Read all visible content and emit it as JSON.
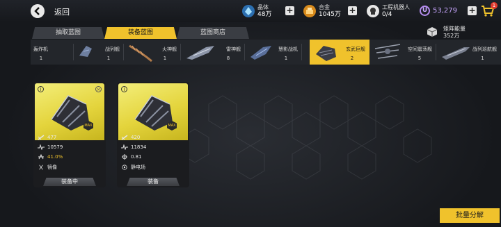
{
  "header": {
    "back_label": "返回",
    "crystal": {
      "label": "晶体",
      "amount": "48万"
    },
    "alloy": {
      "label": "合金",
      "amount": "1045万"
    },
    "robots": {
      "label": "工程机器人",
      "amount": "0/4"
    },
    "u_badge": "U",
    "u_amount": "53,279",
    "cart_badge": "1"
  },
  "tabs": [
    {
      "label": "抽取蓝图",
      "active": false
    },
    {
      "label": "装备蓝图",
      "active": true
    },
    {
      "label": "蓝图商店",
      "active": false
    }
  ],
  "matrix": {
    "label": "矩阵能量",
    "amount": "352万"
  },
  "classes": [
    {
      "name": "轰炸机",
      "count": "1"
    },
    {
      "name": "战列舰",
      "count": "1"
    },
    {
      "name": "火神舰",
      "count": "1"
    },
    {
      "name": "雷神舰",
      "count": "8"
    },
    {
      "name": "慧影战机",
      "count": "1"
    },
    {
      "name": "玄武巨舰",
      "count": "2"
    },
    {
      "name": "空间震荡舰",
      "count": "5"
    },
    {
      "name": "战列巡航舰",
      "count": "1"
    }
  ],
  "cards": [
    {
      "info": "i",
      "close": "×",
      "max": "MAX",
      "attack": "477",
      "health": "10579",
      "crit": "41.0%",
      "skill": "镜像",
      "button": "装备中"
    },
    {
      "info": "i",
      "max": "MAX",
      "attack": "420",
      "health": "11834",
      "crit": "0.81",
      "skill": "静电场",
      "button": "装备"
    }
  ],
  "bulk_button": "批量分解",
  "colors": {
    "accent": "#f0c22c",
    "purple": "#c9a7ff",
    "card_top": "#e4d43c"
  }
}
